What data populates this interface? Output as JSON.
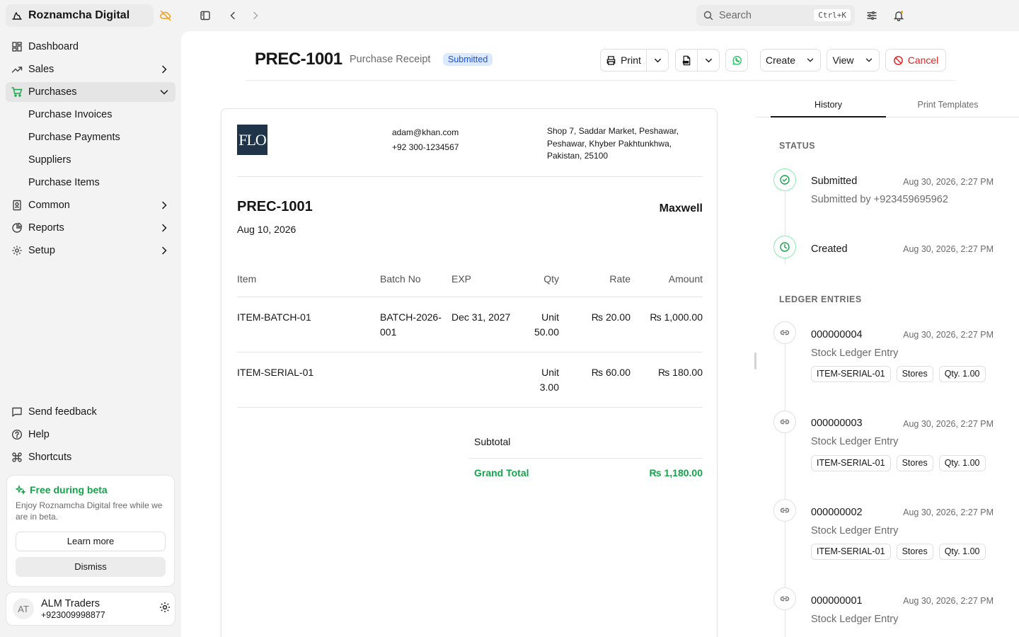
{
  "app": {
    "name": "Roznamcha Digital"
  },
  "sidebar": {
    "items": [
      {
        "label": "Dashboard"
      },
      {
        "label": "Sales"
      },
      {
        "label": "Purchases"
      },
      {
        "label": "Common"
      },
      {
        "label": "Reports"
      },
      {
        "label": "Setup"
      }
    ],
    "purchases_sub": [
      "Purchase Invoices",
      "Purchase Payments",
      "Suppliers",
      "Purchase Items"
    ],
    "bottom": [
      {
        "label": "Send feedback"
      },
      {
        "label": "Help"
      },
      {
        "label": "Shortcuts"
      }
    ],
    "beta": {
      "title": "Free during beta",
      "desc": "Enjoy Roznamcha Digital free while we are in beta.",
      "learn": "Learn more",
      "dismiss": "Dismiss"
    },
    "user": {
      "initials": "AT",
      "name": "ALM Traders",
      "phone": "+923009998877"
    }
  },
  "topbar": {
    "search_placeholder": "Search",
    "shortcut": "Ctrl+K"
  },
  "doc": {
    "id": "PREC-1001",
    "type": "Purchase Receipt",
    "status": "Submitted",
    "actions": {
      "print": "Print",
      "create": "Create",
      "view": "View",
      "cancel": "Cancel"
    }
  },
  "paper": {
    "logo_text": "FLO",
    "email": "adam@khan.com",
    "phone": "+92 300-1234567",
    "address": "Shop 7, Saddar Market, Peshawar, Peshawar, Khyber Pakhtunkhwa, Pakistan, 25100",
    "doc_id": "PREC-1001",
    "date": "Aug 10, 2026",
    "party": "Maxwell",
    "columns": {
      "item": "Item",
      "batch": "Batch No",
      "exp": "EXP",
      "qty": "Qty",
      "rate": "Rate",
      "amount": "Amount"
    },
    "rows": [
      {
        "item": "ITEM-BATCH-01",
        "batch": "BATCH-2026-001",
        "exp": "Dec 31, 2027",
        "qty_unit": "Unit",
        "qty": "50.00",
        "rate": "₨ 20.00",
        "amount": "₨ 1,000.00"
      },
      {
        "item": "ITEM-SERIAL-01",
        "batch": "",
        "exp": "",
        "qty_unit": "Unit",
        "qty": "3.00",
        "rate": "₨ 60.00",
        "amount": "₨ 180.00"
      }
    ],
    "subtotal_label": "Subtotal",
    "grand_total_label": "Grand Total",
    "grand_total": "₨ 1,180.00"
  },
  "panel": {
    "tabs": [
      "History",
      "Print Templates"
    ],
    "status_title": "STATUS",
    "status": [
      {
        "title": "Submitted",
        "time": "Aug 30, 2026, 2:27 PM",
        "sub": "Submitted by +923459695962"
      },
      {
        "title": "Created",
        "time": "Aug 30, 2026, 2:27 PM"
      }
    ],
    "ledger_title": "LEDGER ENTRIES",
    "ledger": [
      {
        "id": "000000004",
        "time": "Aug 30, 2026, 2:27 PM",
        "type": "Stock Ledger Entry",
        "chips": [
          "ITEM-SERIAL-01",
          "Stores",
          "Qty. 1.00"
        ]
      },
      {
        "id": "000000003",
        "time": "Aug 30, 2026, 2:27 PM",
        "type": "Stock Ledger Entry",
        "chips": [
          "ITEM-SERIAL-01",
          "Stores",
          "Qty. 1.00"
        ]
      },
      {
        "id": "000000002",
        "time": "Aug 30, 2026, 2:27 PM",
        "type": "Stock Ledger Entry",
        "chips": [
          "ITEM-SERIAL-01",
          "Stores",
          "Qty. 1.00"
        ]
      },
      {
        "id": "000000001",
        "time": "Aug 30, 2026, 2:27 PM",
        "type": "Stock Ledger Entry"
      }
    ]
  },
  "colors": {
    "accent_green": "#16a34a",
    "danger": "#dc2626",
    "badge_bg": "#dbeafe",
    "badge_fg": "#1d4ed8"
  }
}
